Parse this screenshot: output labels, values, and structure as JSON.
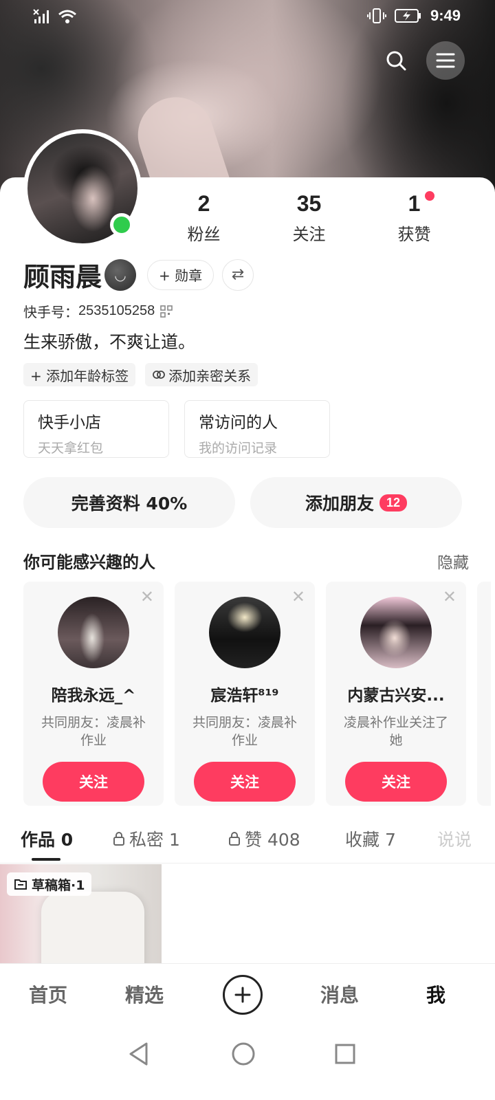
{
  "status_bar": {
    "time": "9:49"
  },
  "header": {
    "search_icon": "search-icon",
    "menu_icon": "menu-icon"
  },
  "profile": {
    "name": "顾雨晨",
    "emoji": "smiling-face-icon",
    "badge_label": "+ 勋章",
    "kuaishou_id_label": "快手号：",
    "kuaishou_id": "2535105258",
    "bio": "生来骄傲，不爽让道。",
    "stats": [
      {
        "value": "2",
        "label": "粉丝"
      },
      {
        "value": "35",
        "label": "关注"
      },
      {
        "value": "1",
        "label": "获赞"
      }
    ],
    "tags": [
      {
        "label": "+ 添加年龄标签"
      },
      {
        "label": "添加亲密关系"
      }
    ],
    "cards": [
      {
        "title": "快手小店",
        "subtitle": "天天拿红包"
      },
      {
        "title": "常访问的人",
        "subtitle": "我的访问记录"
      }
    ],
    "complete_profile": "完善资料 40%",
    "add_friends": "添加朋友",
    "add_friends_count": "12"
  },
  "suggestions": {
    "title": "你可能感兴趣的人",
    "hide_label": "隐藏",
    "items": [
      {
        "name": "陪我永远_^",
        "desc": "共同朋友：凌晨补作业",
        "follow": "关注"
      },
      {
        "name": "宸浩轩⁸¹⁹",
        "desc": "共同朋友：凌晨补作业",
        "follow": "关注"
      },
      {
        "name": "内蒙古兴安...",
        "desc": "凌晨补作业关注了她",
        "follow": "关注"
      }
    ]
  },
  "tabs": [
    {
      "label": "作品 0"
    },
    {
      "label": "私密 1"
    },
    {
      "label": "赞 408"
    },
    {
      "label": "收藏 7"
    },
    {
      "label": "说说"
    }
  ],
  "draft": {
    "label": "草稿箱·1"
  },
  "bottom_nav": {
    "items": [
      {
        "label": "首页"
      },
      {
        "label": "精选"
      },
      {
        "label": "消息"
      },
      {
        "label": "我"
      }
    ]
  },
  "colors": {
    "accent": "#fe3c60",
    "online": "#2fcc4c"
  }
}
